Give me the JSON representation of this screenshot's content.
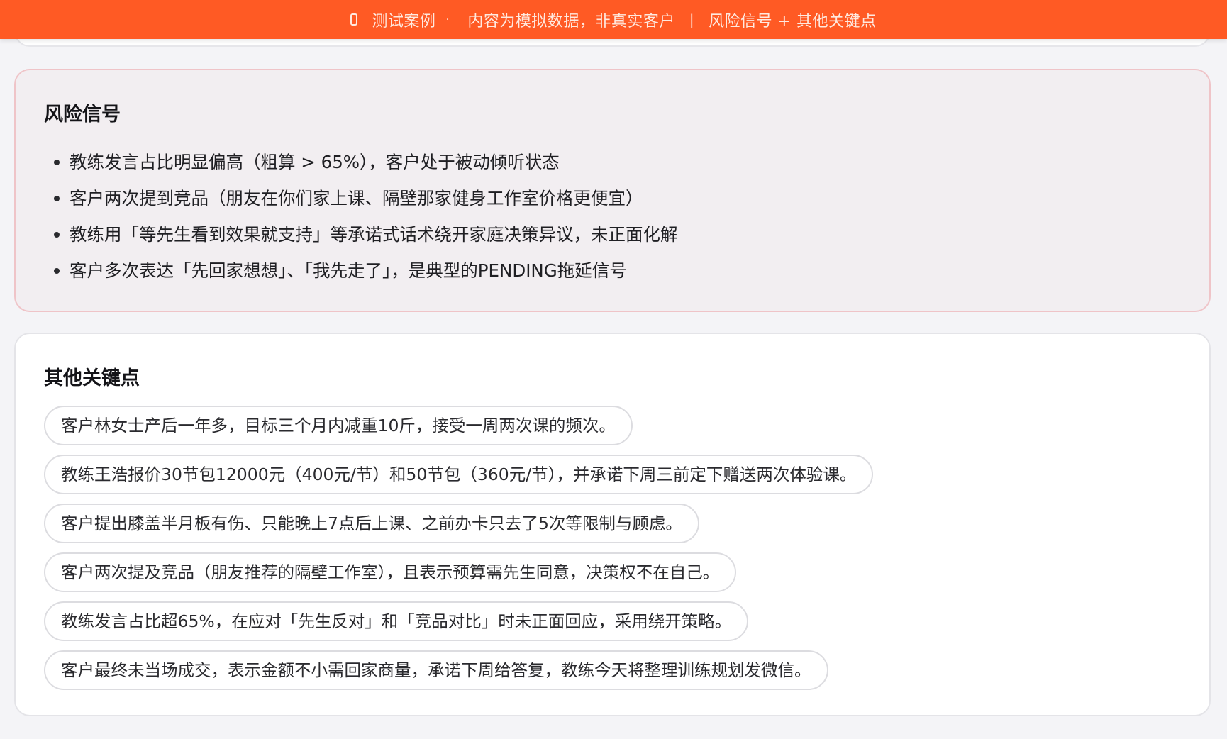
{
  "banner": {
    "label": "测试案例",
    "dot": "·",
    "note": "内容为模拟数据，非真实客户",
    "separator": "|",
    "section": "风险信号 + 其他关键点"
  },
  "risk_signals": {
    "title": "风险信号",
    "items": [
      "教练发言占比明显偏高（粗算 > 65%），客户处于被动倾听状态",
      "客户两次提到竞品（朋友在你们家上课、隔壁那家健身工作室价格更便宜）",
      "教练用「等先生看到效果就支持」等承诺式话术绕开家庭决策异议，未正面化解",
      "客户多次表达「先回家想想」、「我先走了」，是典型的PENDING拖延信号"
    ]
  },
  "key_points": {
    "title": "其他关键点",
    "items": [
      "客户林女士产后一年多，目标三个月内减重10斤，接受一周两次课的频次。",
      "教练王浩报价30节包12000元（400元/节）和50节包（360元/节），并承诺下周三前定下赠送两次体验课。",
      "客户提出膝盖半月板有伤、只能晚上7点后上课、之前办卡只去了5次等限制与顾虑。",
      "客户两次提及竞品（朋友推荐的隔壁工作室），且表示预算需先生同意，决策权不在自己。",
      "教练发言占比超65%，在应对「先生反对」和「竞品对比」时未正面回应，采用绕开策略。",
      "客户最终未当场成交，表示金额不小需回家商量，承诺下周给答复，教练今天将整理训练规划发微信。"
    ]
  },
  "colors": {
    "banner": "#ff5a24",
    "risk_card_bg": "#f2eef1",
    "risk_card_border": "#efc4c8",
    "page_bg": "#f4f4f7"
  }
}
